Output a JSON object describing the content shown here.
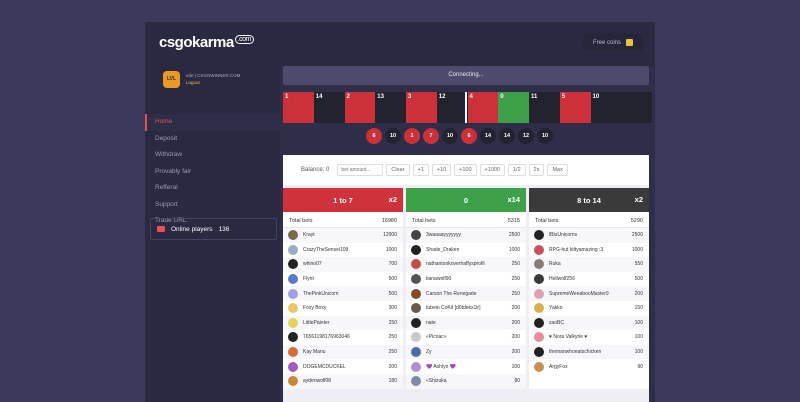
{
  "brand": {
    "logo": "csgo",
    "logo_accent": "karma",
    "logo_suffix": ".com"
  },
  "header": {
    "free_coins_label": "Free coins",
    "coin_icon": "coin-icon"
  },
  "user": {
    "name": "ede | CSGOWINNER.COM",
    "logout": "Logout",
    "badge": "LVL"
  },
  "nav": {
    "items": [
      {
        "label": "Home",
        "active": true
      },
      {
        "label": "Deposit"
      },
      {
        "label": "Withdraw"
      },
      {
        "label": "Provably fair"
      },
      {
        "label": "Refferal"
      },
      {
        "label": "Support"
      },
      {
        "label": "Trade URL"
      }
    ]
  },
  "online": {
    "label": "Online players",
    "count": "136"
  },
  "status": "Connecting...",
  "roll": [
    {
      "n": "1",
      "c": "red"
    },
    {
      "n": "14",
      "c": "black"
    },
    {
      "n": "2",
      "c": "red"
    },
    {
      "n": "13",
      "c": "black"
    },
    {
      "n": "3",
      "c": "red"
    },
    {
      "n": "12",
      "c": "black"
    },
    {
      "n": "4",
      "c": "red"
    },
    {
      "n": "0",
      "c": "green"
    },
    {
      "n": "11",
      "c": "black"
    },
    {
      "n": "5",
      "c": "red"
    },
    {
      "n": "10",
      "c": "black"
    },
    {
      "n": "",
      "c": "black"
    }
  ],
  "history": [
    {
      "n": "6",
      "c": "red"
    },
    {
      "n": "10",
      "c": "black"
    },
    {
      "n": "1",
      "c": "red"
    },
    {
      "n": "7",
      "c": "red"
    },
    {
      "n": "10",
      "c": "black"
    },
    {
      "n": "6",
      "c": "red"
    },
    {
      "n": "14",
      "c": "black"
    },
    {
      "n": "14",
      "c": "black"
    },
    {
      "n": "12",
      "c": "black"
    },
    {
      "n": "10",
      "c": "black"
    }
  ],
  "betbar": {
    "balance_label": "Balance:",
    "balance_value": "0",
    "input_placeholder": "bet amount...",
    "buttons": [
      "Clear",
      "+1",
      "+10",
      "+100",
      "+1000",
      "1/2",
      "2x",
      "Max"
    ]
  },
  "columns": [
    {
      "title": "1 to 7",
      "mult": "x2",
      "color": "red",
      "total_label": "Total bets",
      "total": "16980",
      "rows": [
        {
          "name": "Krayt",
          "amount": "12000",
          "av": "#7a6a4a"
        },
        {
          "name": "CrazyTheSensei109",
          "amount": "1000",
          "av": "#9aa9c8"
        },
        {
          "name": "whino07",
          "amount": "700",
          "av": "#222"
        },
        {
          "name": "Flynt",
          "amount": "500",
          "av": "#5a7ac8"
        },
        {
          "name": "ThePinkUnicorn",
          "amount": "500",
          "av": "#a0a0e0"
        },
        {
          "name": "Foxy Boxy",
          "amount": "300",
          "av": "#e8c86a"
        },
        {
          "name": "LittlePainter",
          "amount": "250",
          "av": "#e6d15a"
        },
        {
          "name": "76561198176963046",
          "amount": "250",
          "av": "#222"
        },
        {
          "name": "Kay Manu",
          "amount": "250",
          "av": "#d96a3a"
        },
        {
          "name": "DOGEMCDUCKEL",
          "amount": "200",
          "av": "#a05ac0"
        },
        {
          "name": "aydenwolf08",
          "amount": "180",
          "av": "#c88a3a"
        }
      ]
    },
    {
      "title": "0",
      "mult": "x14",
      "color": "green",
      "total_label": "Total bets",
      "total": "5315",
      "rows": [
        {
          "name": "3waaaayyyyyyy",
          "amount": "2500",
          "av": "#444"
        },
        {
          "name": "Shade_Draken",
          "amount": "1000",
          "av": "#222"
        },
        {
          "name": "nathantookoverhaffysprofil",
          "amount": "250",
          "av": "#c84a4a"
        },
        {
          "name": "tianawolf90",
          "amount": "250",
          "av": "#555"
        },
        {
          "name": "Carson The Renegade",
          "amount": "250",
          "av": "#8a4a2a"
        },
        {
          "name": "tubein CoKit [d0tdekx1ir]",
          "amount": "200",
          "av": "#6a5a4a"
        },
        {
          "name": "nate",
          "amount": "200",
          "av": "#222"
        },
        {
          "name": "«Picnac»",
          "amount": "200",
          "av": "#c8c8d0"
        },
        {
          "name": "Zy",
          "amount": "200",
          "av": "#4a6aa8"
        },
        {
          "name": "💜 Ashlyn 💜",
          "amount": "100",
          "av": "#b090d0"
        },
        {
          "name": "«Shizuka",
          "amount": "80",
          "av": "#7a8aa8"
        }
      ]
    },
    {
      "title": "8 to 14",
      "mult": "x2",
      "color": "black",
      "total_label": "Total bets",
      "total": "5290",
      "rows": [
        {
          "name": "lBluUnicorns",
          "amount": "2500",
          "av": "#222"
        },
        {
          "name": "RPG-hut kittyamazing :3",
          "amount": "1000",
          "av": "#c8505a"
        },
        {
          "name": "Ruka",
          "amount": "550",
          "av": "#8a7a7a"
        },
        {
          "name": "Hellwolf256",
          "amount": "500",
          "av": "#3a3a3a"
        },
        {
          "name": "SupremeWeeabooMaster9",
          "amount": "200",
          "av": "#e0a0b0"
        },
        {
          "name": "Yakko",
          "amount": "150",
          "av": "#d8b050"
        },
        {
          "name": "zaoBC",
          "amount": "100",
          "av": "#222"
        },
        {
          "name": "♥ Nora Valkyrie ♥",
          "amount": "100",
          "av": "#e88aa0"
        },
        {
          "name": "themanwhoeatschicken",
          "amount": "100",
          "av": "#222"
        },
        {
          "name": "ArgyFox",
          "amount": "90",
          "av": "#c89050"
        }
      ]
    }
  ]
}
